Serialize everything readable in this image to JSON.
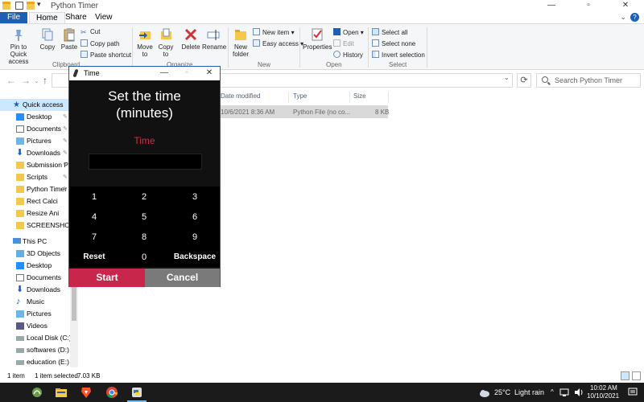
{
  "explorer": {
    "title": "Python Timer",
    "tabs": [
      "File",
      "Home",
      "Share",
      "View"
    ],
    "ribbon": {
      "clipboard": {
        "pin": "Pin to Quick access",
        "copy": "Copy",
        "paste": "Paste",
        "cut": "Cut",
        "copy_path": "Copy path",
        "paste_shortcut": "Paste shortcut",
        "label": "Clipboard"
      },
      "organize": {
        "move_to": "Move to",
        "copy_to": "Copy to",
        "delete": "Delete",
        "rename": "Rename",
        "label": "Organize"
      },
      "new": {
        "new_folder": "New folder",
        "new_item": "New item",
        "easy_access": "Easy access",
        "label": "New"
      },
      "open": {
        "properties": "Properties",
        "open": "Open",
        "edit": "Edit",
        "history": "History",
        "label": "Open"
      },
      "select": {
        "select_all": "Select all",
        "select_none": "Select none",
        "invert": "Invert selection",
        "label": "Select"
      }
    },
    "search_placeholder": "Search Python Timer",
    "nav": [
      "Quick access",
      "Desktop",
      "Documents",
      "Pictures",
      "Downloads",
      "Submission P",
      "Scripts",
      "Python Timer",
      "Rect Calci",
      "Resize Ani",
      "SCREENSHOTS",
      "This PC",
      "3D Objects",
      "Desktop",
      "Documents",
      "Downloads",
      "Music",
      "Pictures",
      "Videos",
      "Local Disk (C:)",
      "softwares (D:)",
      "education (E:)"
    ],
    "columns": [
      "Date modified",
      "Type",
      "Size"
    ],
    "file_row": {
      "date": "10/6/2021 8:36 AM",
      "type": "Python File (no co...",
      "size": "8 KB"
    },
    "status": {
      "count": "1 item",
      "selected": "1 item selected",
      "size": "7.03 KB"
    }
  },
  "dialog": {
    "title": "Time",
    "heading_line1": "Set the time",
    "heading_line2": "(minutes)",
    "time_label": "Time",
    "entry_value": "",
    "keys": [
      "1",
      "2",
      "3",
      "4",
      "5",
      "6",
      "7",
      "8",
      "9",
      "Reset",
      "0",
      "Backspace"
    ],
    "start": "Start",
    "cancel": "Cancel"
  },
  "taskbar": {
    "weather": "25°C",
    "weather_desc": "Light rain",
    "time": "10:02 AM",
    "date": "10/10/2021"
  },
  "colors": {
    "accent": "#1e5fb3",
    "start_button": "#c8264a",
    "cancel_button": "#7a7a7a",
    "time_label": "#d22a4b"
  }
}
